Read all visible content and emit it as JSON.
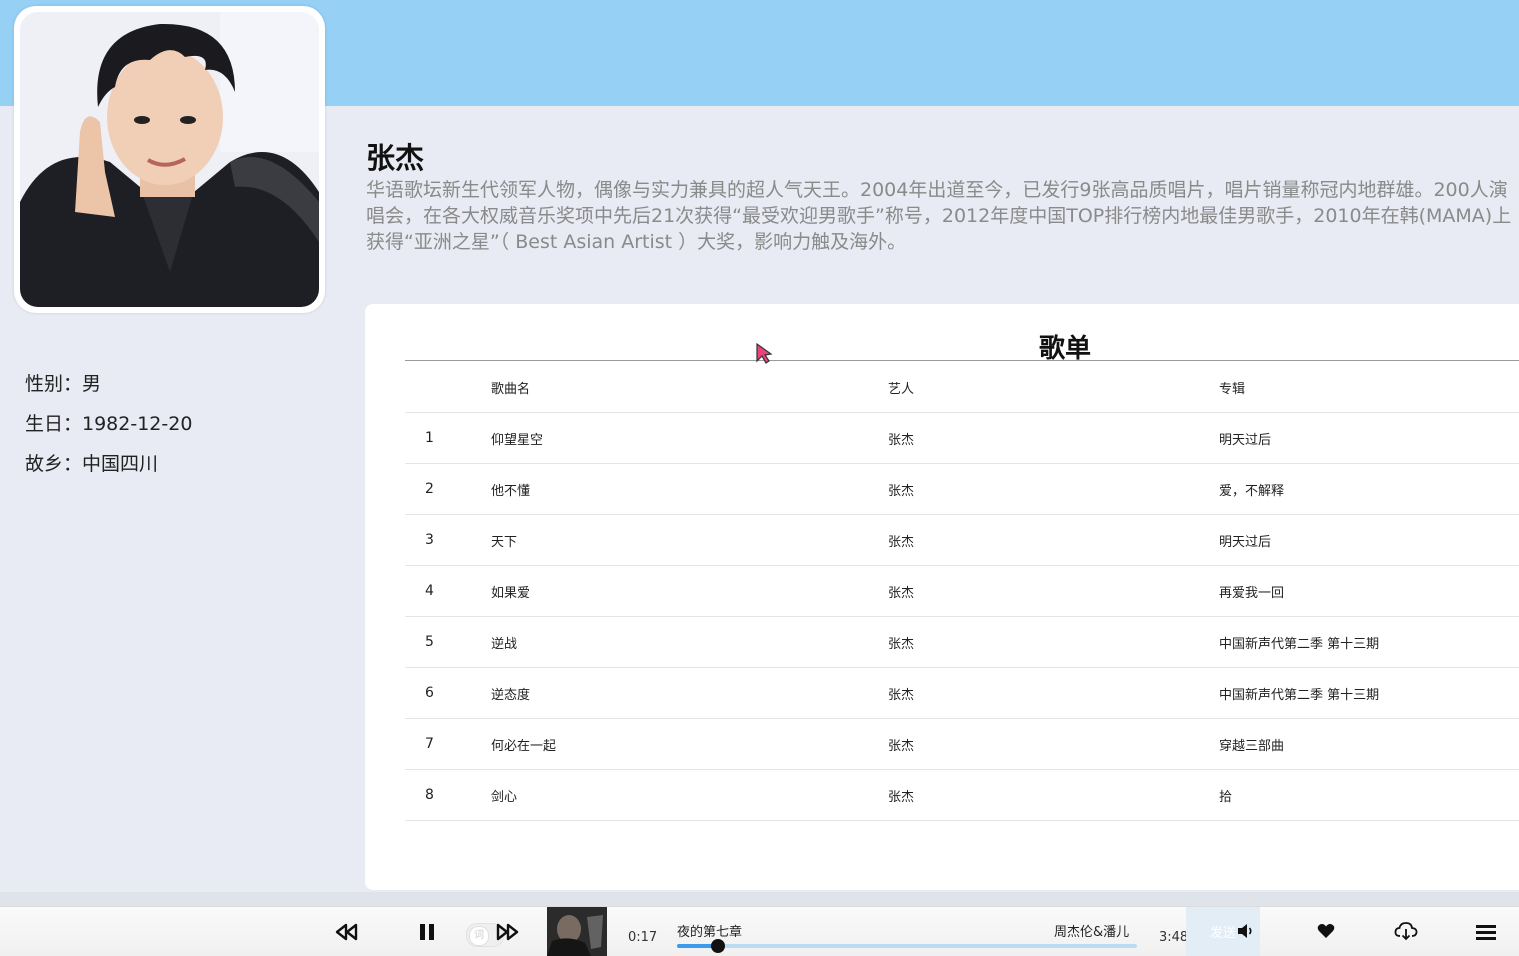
{
  "artist": {
    "name": "张杰",
    "bio": "华语歌坛新生代领军人物，偶像与实力兼具的超人气天王。2004年出道至今，已发行9张高品质唱片，唱片销量称冠内地群雄。200人演唱会，在各大权威音乐奖项中先后21次获得“最受欢迎男歌手”称号，2012年度中国TOP排行榜内地最佳男歌手，2010年在韩(MAMA)上获得“亚洲之星”（ Best Asian Artist ）大奖，影响力触及海外。",
    "gender": "性别：男",
    "birthday": "生日：1982-12-20",
    "hometown": "故乡：中国四川"
  },
  "playlist": {
    "title": "歌单",
    "headers": {
      "index": "",
      "name": "歌曲名",
      "artist": "艺人",
      "album": "专辑"
    },
    "songs": [
      {
        "index": "1",
        "name": "仰望星空",
        "artist": "张杰",
        "album": "明天过后"
      },
      {
        "index": "2",
        "name": "他不懂",
        "artist": "张杰",
        "album": "爱，不解释"
      },
      {
        "index": "3",
        "name": "天下",
        "artist": "张杰",
        "album": "明天过后"
      },
      {
        "index": "4",
        "name": "如果爱",
        "artist": "张杰",
        "album": "再爱我一回"
      },
      {
        "index": "5",
        "name": "逆战",
        "artist": "张杰",
        "album": "中国新声代第二季 第十三期"
      },
      {
        "index": "6",
        "name": "逆态度",
        "artist": "张杰",
        "album": "中国新声代第二季 第十三期"
      },
      {
        "index": "7",
        "name": "何必在一起",
        "artist": "张杰",
        "album": "穿越三部曲"
      },
      {
        "index": "8",
        "name": "剑心",
        "artist": "张杰",
        "album": "拾"
      }
    ]
  },
  "player": {
    "current_time": "0:17",
    "total_time": "3:48",
    "song_title": "夜的第七章",
    "song_artist": "周杰伦&潘儿",
    "progress": 0.09,
    "send_label": "发送",
    "toggle_label": "词",
    "icons": [
      "previous-icon",
      "pause-icon",
      "next-icon",
      "volume-icon",
      "heart-icon",
      "download-icon",
      "menu-icon"
    ]
  },
  "colors": {
    "header_band": "#96d0f5",
    "accent": "#3d9be9",
    "background": "#e8ebf3"
  }
}
